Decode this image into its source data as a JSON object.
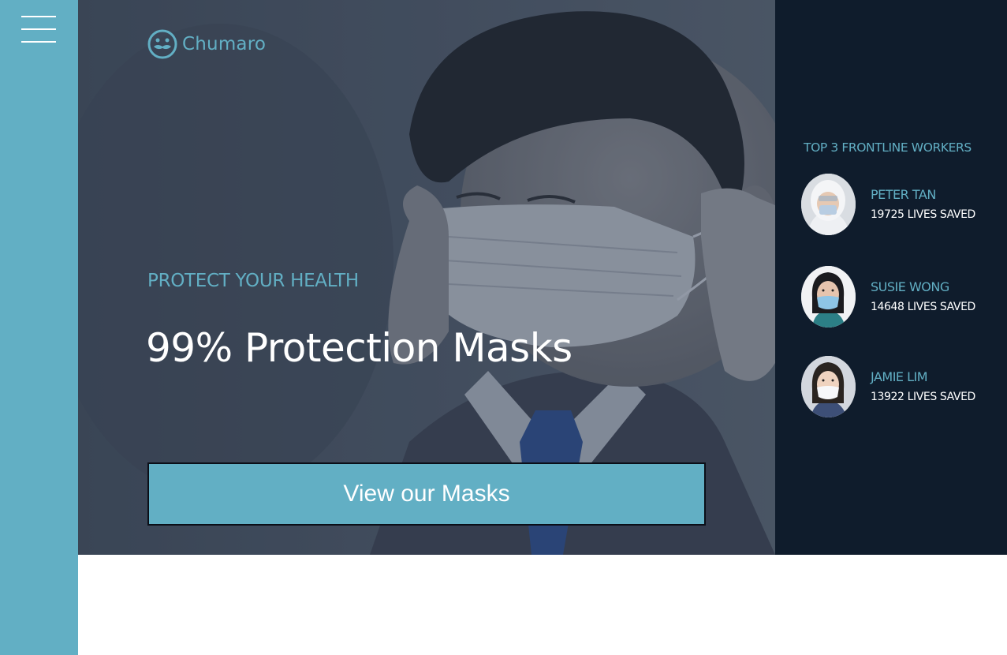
{
  "brand": {
    "name": "Chumaro",
    "logo_icon": "mustache-face-icon"
  },
  "sidebar": {
    "menu_icon": "hamburger-menu-icon"
  },
  "hero": {
    "eyebrow": "PROTECT YOUR HEALTH",
    "headline": "99% Protection Masks",
    "cta_label": "View our Masks"
  },
  "panel": {
    "title": "TOP 3 FRONTLINE WORKERS",
    "workers": [
      {
        "name": "PETER TAN",
        "stat": "19725 LIVES SAVED"
      },
      {
        "name": "SUSIE WONG",
        "stat": "14648 LIVES SAVED"
      },
      {
        "name": "JAMIE LIM",
        "stat": "13922 LIVES SAVED"
      }
    ]
  },
  "colors": {
    "accent": "#62afc4",
    "panel_bg": "#0f1c2c",
    "sidebar_bg": "#62afc4",
    "text_light": "#ffffff"
  }
}
